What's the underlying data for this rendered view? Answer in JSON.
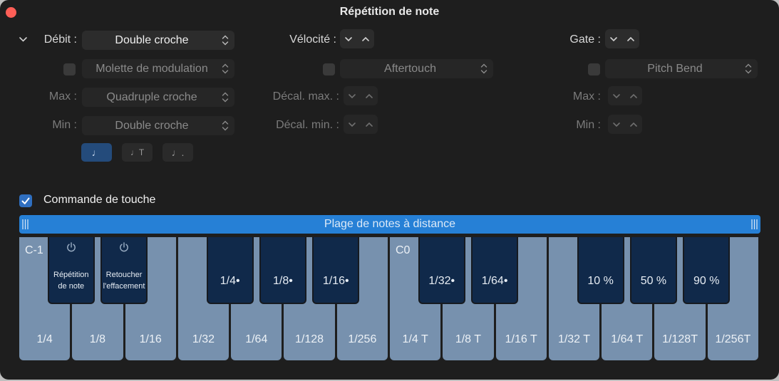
{
  "window": {
    "title": "Répétition de note"
  },
  "rate": {
    "disclosure_icon": "chevron-down-icon",
    "label": "Débit :",
    "value": "Double croche",
    "modulation_source": "Molette de modulation",
    "max_label": "Max :",
    "max_value": "Quadruple croche",
    "min_label": "Min :",
    "min_value": "Double croche",
    "note_types": [
      {
        "name": "normal",
        "glyph": "♩",
        "active": true
      },
      {
        "name": "triplet",
        "glyph": "♩T",
        "active": false
      },
      {
        "name": "dotted",
        "glyph": "♩.",
        "active": false
      }
    ]
  },
  "velocity": {
    "label": "Vélocité :",
    "modulation_source": "Aftertouch",
    "max_label": "Décal. max. :",
    "min_label": "Décal. min. :"
  },
  "gate": {
    "label": "Gate :",
    "modulation_source": "Pitch Bend",
    "max_label": "Max :",
    "min_label": "Min :"
  },
  "key_command": {
    "checked": true,
    "label": "Commande de touche",
    "range_label": "Plage de notes à distance"
  },
  "keyboard": {
    "octave_labels": [
      "C-1",
      "C0"
    ],
    "white_keys": [
      "1/4",
      "1/8",
      "1/16",
      "1/32",
      "1/64",
      "1/128",
      "1/256",
      "1/4 T",
      "1/8 T",
      "1/16 T",
      "1/32 T",
      "1/64 T",
      "1/128T",
      "1/256T"
    ],
    "black_keys": [
      {
        "label": "Répétition de note",
        "icon": "power-icon"
      },
      {
        "label": "Retoucher l'effacement",
        "icon": "power-icon"
      },
      {
        "label": "1/4•"
      },
      {
        "label": "1/8•"
      },
      {
        "label": "1/16•"
      },
      {
        "label": "1/32•"
      },
      {
        "label": "1/64•"
      },
      {
        "label": "10 %"
      },
      {
        "label": "50 %"
      },
      {
        "label": "90 %"
      }
    ]
  },
  "colors": {
    "background": "#1e1e1e",
    "accent": "#2680d6",
    "white_key": "#7791ae",
    "black_key": "#10294a",
    "close": "#fe5f57"
  }
}
